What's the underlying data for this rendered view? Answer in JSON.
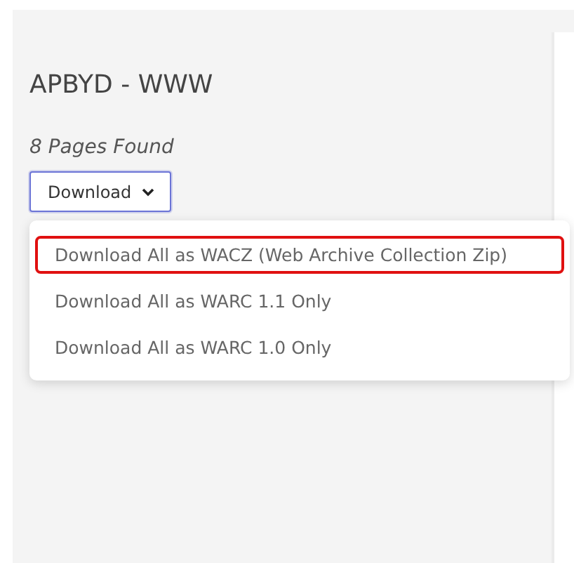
{
  "title": "APBYD - WWW",
  "count": "8 Pages Found",
  "download_button": {
    "label": "Download",
    "expanded": true
  },
  "menu": [
    {
      "label": "Download All as WACZ (Web Archive Collection Zip)",
      "selected": true
    },
    {
      "label": "Download All as WARC 1.1 Only",
      "selected": false
    },
    {
      "label": "Download All as WARC 1.0 Only",
      "selected": false
    }
  ]
}
